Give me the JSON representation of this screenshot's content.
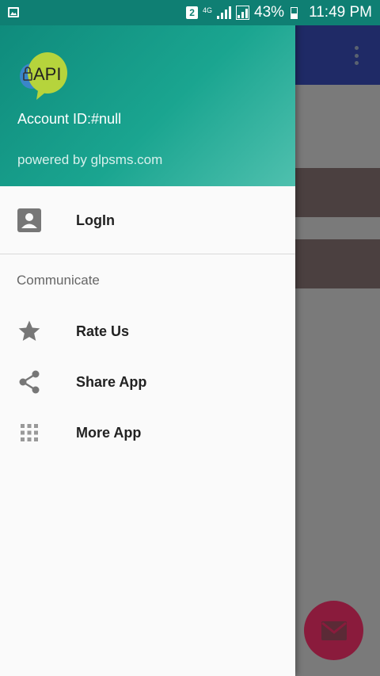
{
  "status_bar": {
    "sim_slot": "2",
    "network_type": "4G",
    "battery_percent": "43%",
    "time": "11:49 PM"
  },
  "drawer": {
    "header": {
      "logo_text": "API",
      "account_id": "Account ID:#null",
      "powered_by": "powered by glpsms.com"
    },
    "items": [
      {
        "label": "LogIn",
        "icon": "account-box-icon"
      }
    ],
    "section": {
      "title": "Communicate",
      "items": [
        {
          "label": "Rate Us",
          "icon": "star-icon"
        },
        {
          "label": "Share App",
          "icon": "share-icon"
        },
        {
          "label": "More App",
          "icon": "apps-grid-icon"
        }
      ]
    }
  },
  "background_app": {
    "fab_icon": "mail-icon",
    "overflow_icon": "more-vert-icon"
  },
  "colors": {
    "header_gradient_start": "#0f8b7c",
    "header_gradient_end": "#4fc0ae",
    "toolbar": "#1f2a66",
    "fab": "#8a1b3c"
  }
}
